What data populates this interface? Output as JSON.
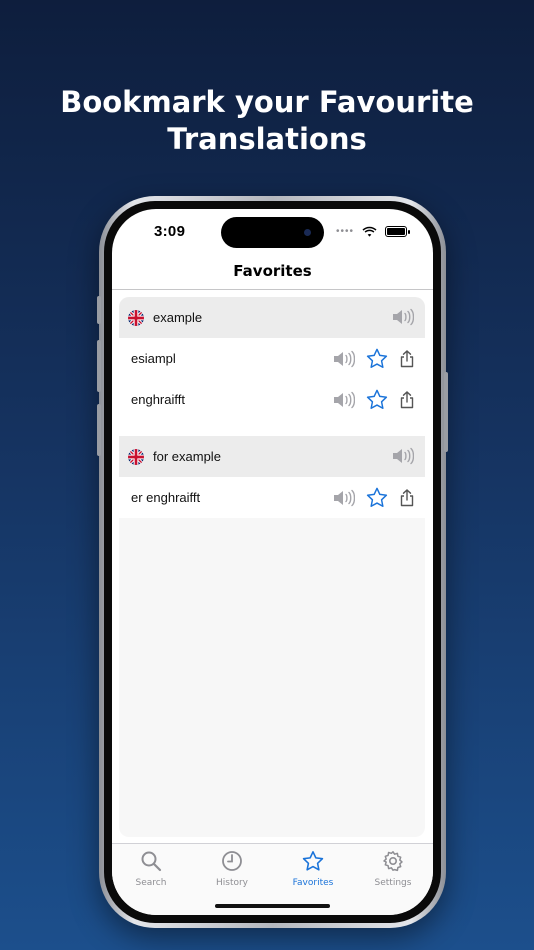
{
  "headline": {
    "line1": "Bookmark your Favourite",
    "line2": "Translations"
  },
  "status_bar": {
    "time": "3:09",
    "icons": [
      "dots-icon",
      "wifi-icon",
      "battery-icon"
    ]
  },
  "navbar": {
    "title": "Favorites"
  },
  "groups": [
    {
      "header": "example",
      "flag": "uk-flag-icon",
      "translations": [
        "esiampl",
        "enghraifft"
      ]
    },
    {
      "header": "for example",
      "flag": "uk-flag-icon",
      "translations": [
        "er enghraifft"
      ]
    }
  ],
  "tabbar": {
    "tabs": [
      {
        "label": "Search",
        "icon": "search-icon",
        "active": false
      },
      {
        "label": "History",
        "icon": "clock-icon",
        "active": false
      },
      {
        "label": "Favorites",
        "icon": "star-icon",
        "active": true
      },
      {
        "label": "Settings",
        "icon": "gear-icon",
        "active": false
      }
    ]
  },
  "colors": {
    "accent": "#1a73d9",
    "speaker_gray": "#a5a5aa",
    "header_bg": "#ececec",
    "background_top": "#0e1e3d",
    "background_bottom": "#1c4f8c"
  }
}
